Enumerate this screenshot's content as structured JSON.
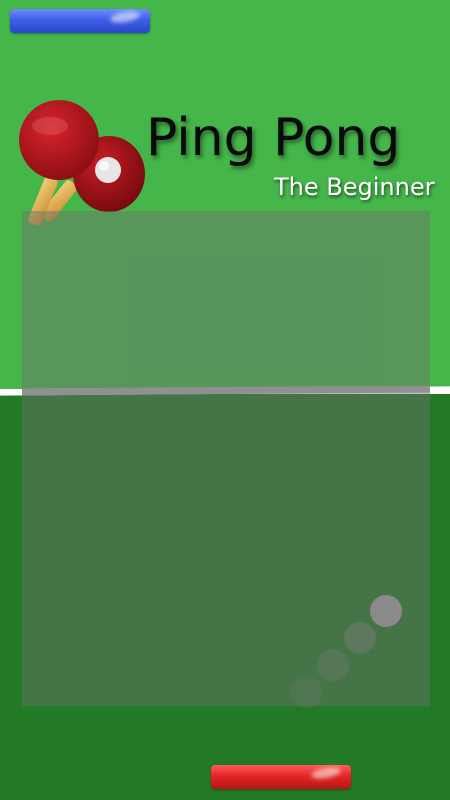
{
  "title": "Ping Pong",
  "subtitle": "The Beginner",
  "colors": {
    "field_top": "#45b64a",
    "field_bottom": "#237a26",
    "top_paddle": "#3e5ee8",
    "bottom_paddle": "#e32626",
    "ball": "#8a8a8a"
  },
  "icons": {
    "logo": "ping-pong-paddles-icon",
    "ball": "ball-icon"
  }
}
